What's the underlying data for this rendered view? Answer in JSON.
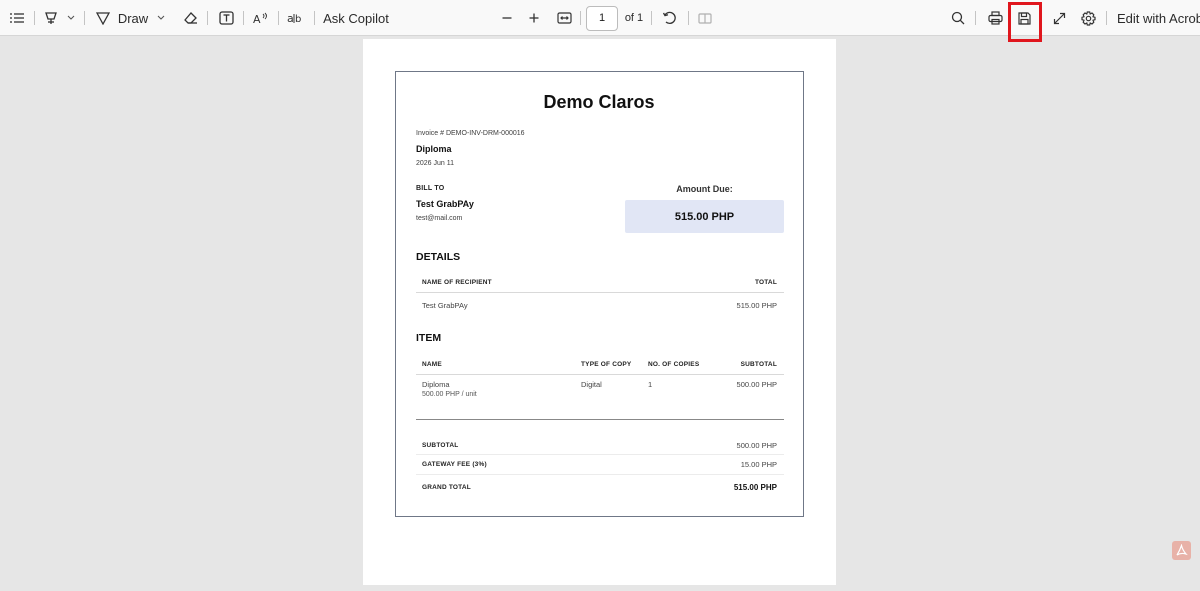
{
  "toolbar": {
    "draw_label": "Draw",
    "ask_copilot_label": "Ask Copilot",
    "page_number": "1",
    "page_total": "of 1",
    "edit_with_acrobat_label": "Edit with Acrobat",
    "icons": [
      "contents-icon",
      "highlight-icon",
      "chevron-down-icon",
      "draw-icon",
      "chevron-down-icon",
      "eraser-icon",
      "text-box-icon",
      "read-aloud-icon",
      "translate-icon",
      "zoom-out-icon",
      "zoom-in-icon",
      "fit-width-icon",
      "rotate-icon",
      "page-view-icon",
      "search-icon",
      "print-icon",
      "save-icon",
      "fullscreen-icon",
      "settings-icon"
    ]
  },
  "invoice": {
    "company": "Demo Claros",
    "invoice_number": "Invoice # DEMO-INV-DRM-000016",
    "document_type": "Diploma",
    "date": "2026 Jun 11",
    "bill_to_label": "BILL TO",
    "bill_to_name": "Test GrabPAy",
    "bill_to_email": "test@mail.com",
    "amount_due_label": "Amount Due:",
    "amount_due": "515.00 PHP",
    "details_title": "DETAILS",
    "details_headers": {
      "recipient": "NAME OF RECIPIENT",
      "total": "TOTAL"
    },
    "details_row": {
      "recipient": "Test GrabPAy",
      "total": "515.00 PHP"
    },
    "item_title": "ITEM",
    "item_headers": {
      "name": "NAME",
      "type": "TYPE OF COPY",
      "copies": "NO. OF COPIES",
      "subtotal": "SUBTOTAL"
    },
    "item_row": {
      "name": "Diploma",
      "unit_price": "500.00 PHP / unit",
      "type": "Digital",
      "copies": "1",
      "subtotal": "500.00 PHP"
    },
    "summary": {
      "subtotal_label": "SUBTOTAL",
      "subtotal": "500.00 PHP",
      "fee_label": "GATEWAY FEE (3%)",
      "fee": "15.00 PHP",
      "grand_total_label": "GRAND TOTAL",
      "grand_total": "515.00 PHP"
    }
  },
  "colors": {
    "highlight_border": "#e0161d",
    "amount_box": "#e1e6f5"
  }
}
